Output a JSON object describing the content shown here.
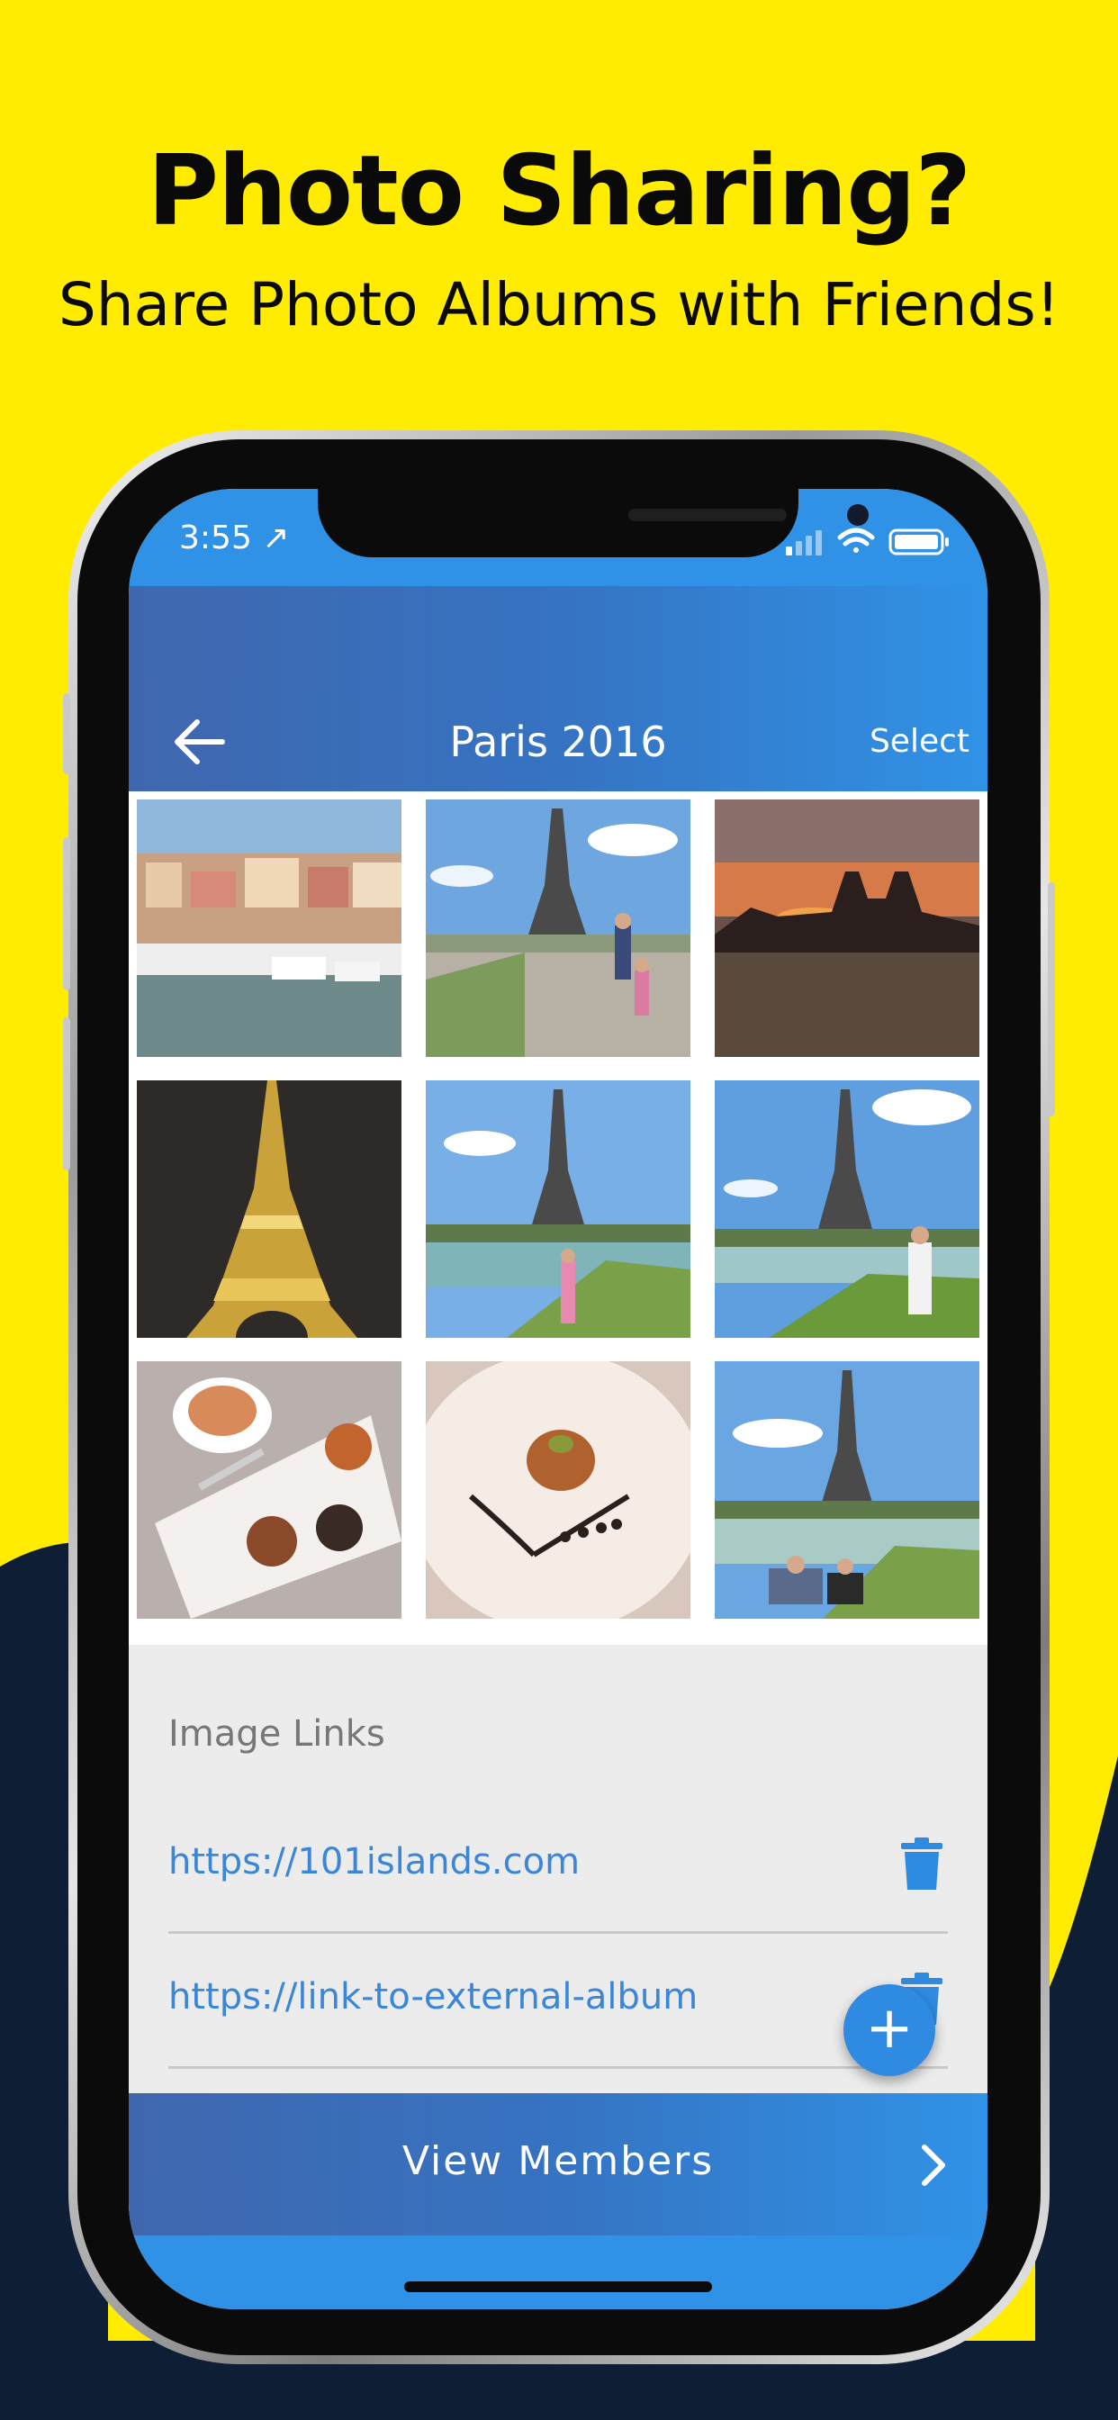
{
  "promo": {
    "headline": "Photo Sharing?",
    "subheadline": "Share Photo Albums with Friends!"
  },
  "status_bar": {
    "time": "3:55 ↗"
  },
  "header": {
    "title": "Paris 2016",
    "select_label": "Select",
    "back_icon": "back-arrow-icon"
  },
  "photos": [
    {
      "subject": "harbor town"
    },
    {
      "subject": "eiffel tower with kids"
    },
    {
      "subject": "sunset over notre dame"
    },
    {
      "subject": "eiffel tower at night"
    },
    {
      "subject": "eiffel tower with child"
    },
    {
      "subject": "eiffel tower with man"
    },
    {
      "subject": "tea and pastries"
    },
    {
      "subject": "plated dessert"
    },
    {
      "subject": "eiffel tower with couple"
    }
  ],
  "image_links": {
    "section_label": "Image Links",
    "links": [
      {
        "url": "https://101islands.com"
      },
      {
        "url": "https://link-to-external-album"
      }
    ]
  },
  "fab_label": "+",
  "members_button": {
    "label": "View Members"
  },
  "colors": {
    "background_yellow": "#FFEC00",
    "navy": "#0E1E35",
    "header_blue": "#3092E6",
    "link_blue": "#3A86D8"
  }
}
